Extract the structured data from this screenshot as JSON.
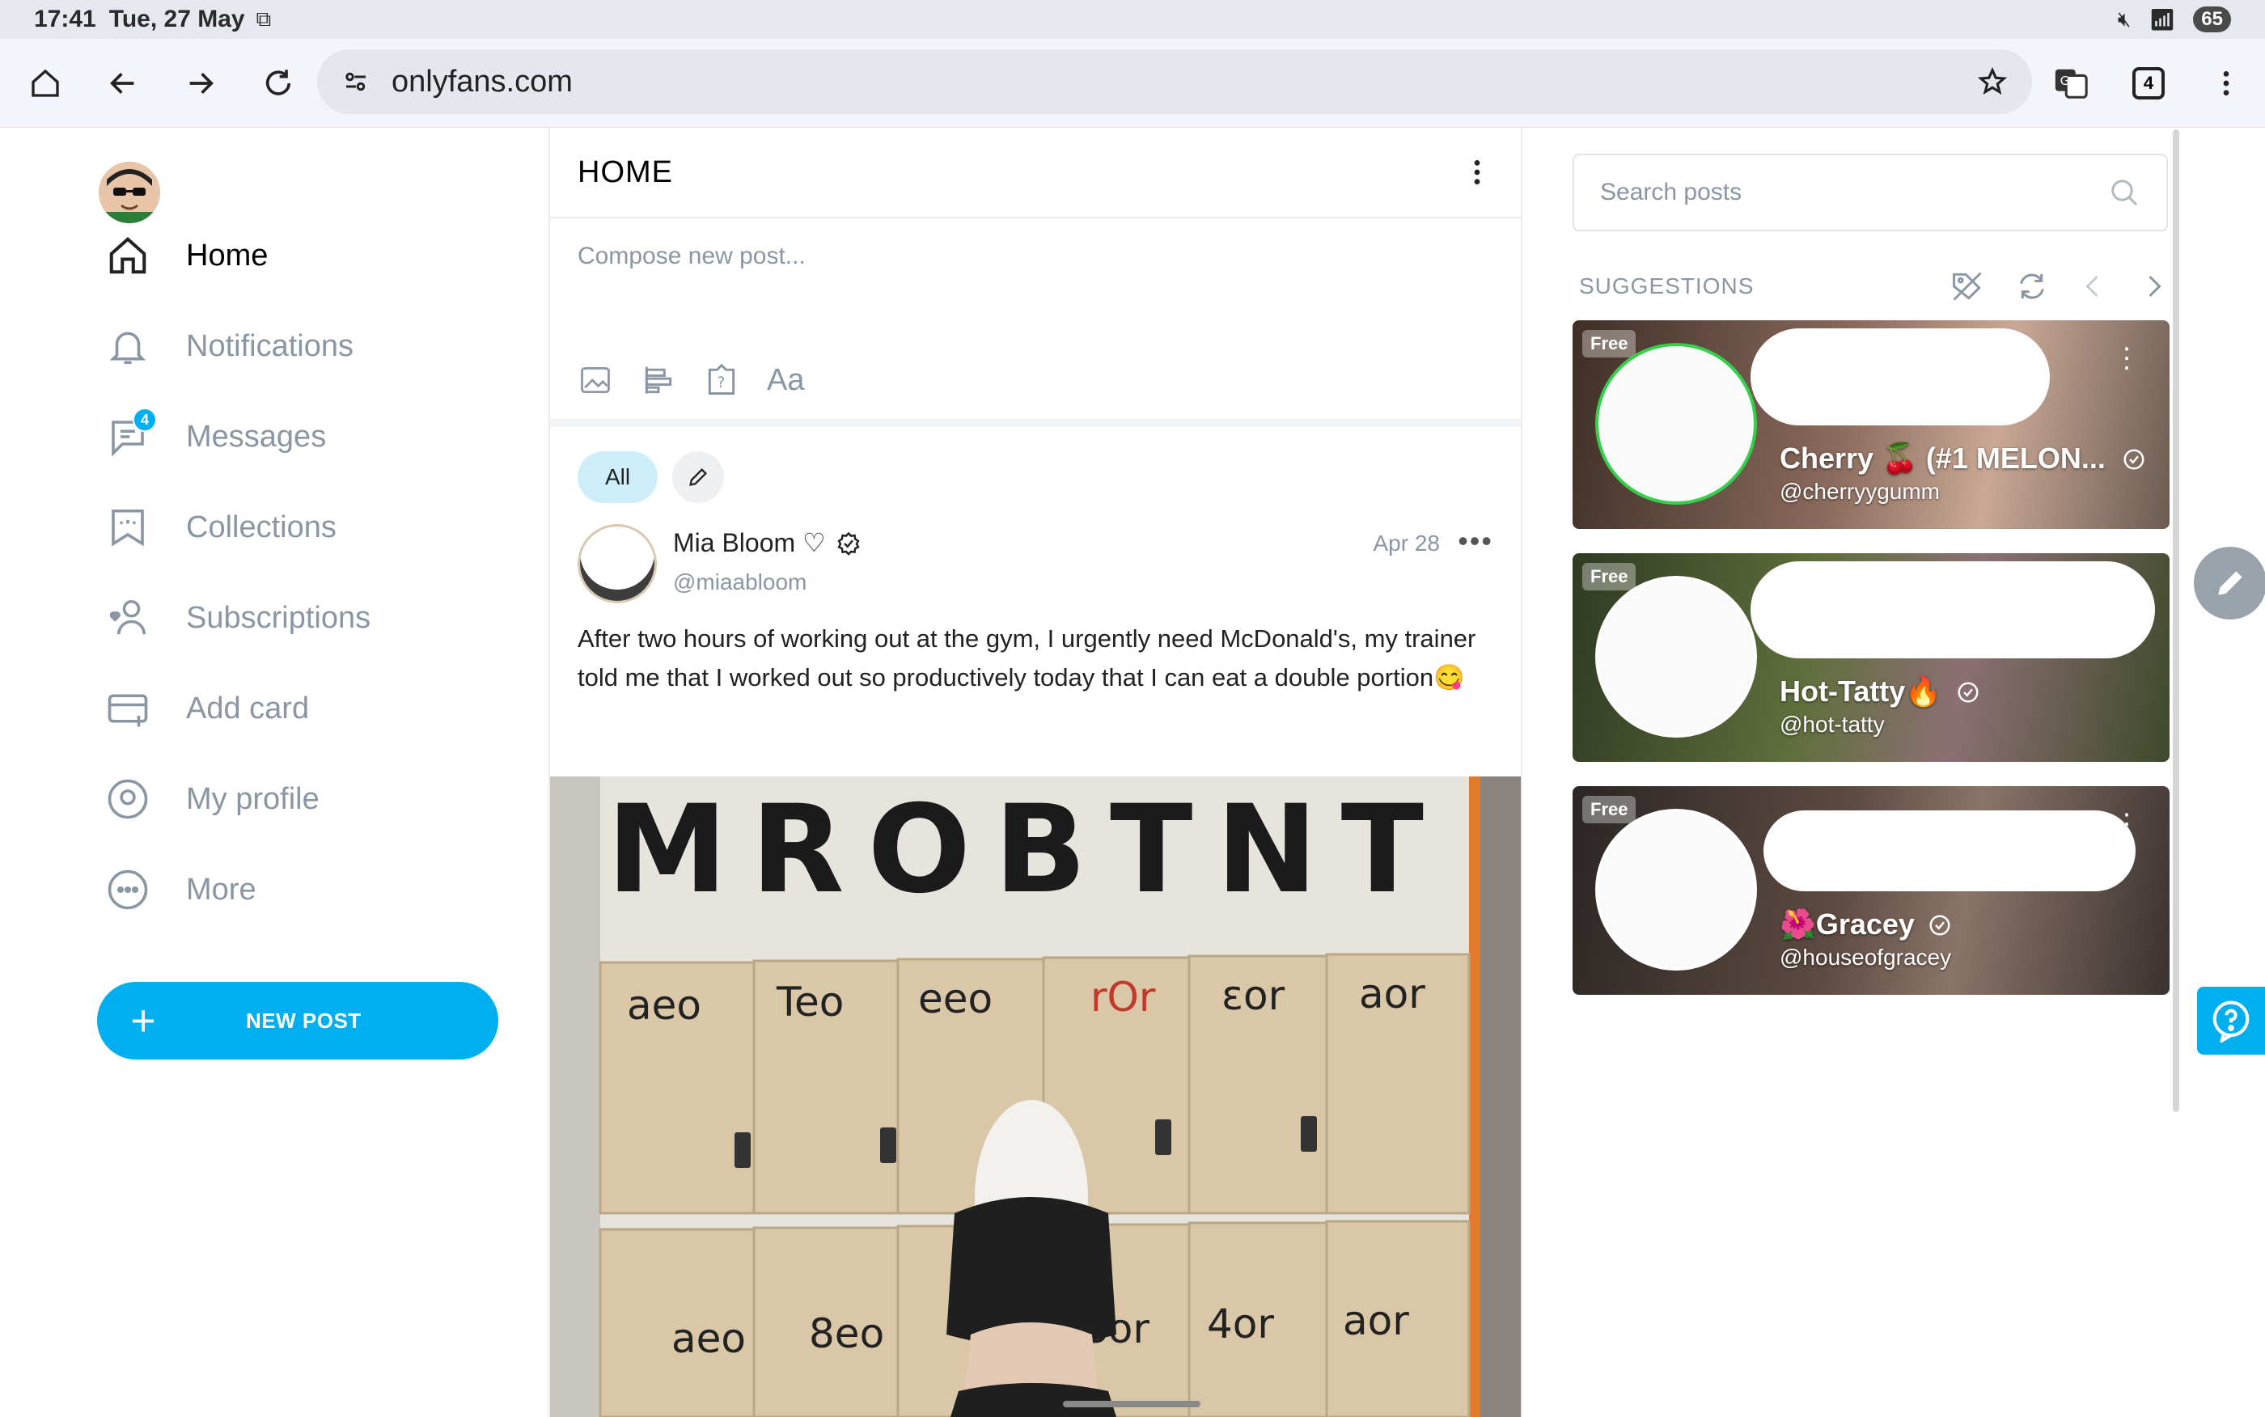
{
  "status": {
    "time": "17:41",
    "date": "Tue, 27 May",
    "battery": "65"
  },
  "browser": {
    "url": "onlyfans.com",
    "tab_count": "4"
  },
  "nav": {
    "items": [
      {
        "label": "Home"
      },
      {
        "label": "Notifications"
      },
      {
        "label": "Messages",
        "badge": "4"
      },
      {
        "label": "Collections"
      },
      {
        "label": "Subscriptions"
      },
      {
        "label": "Add card"
      },
      {
        "label": "My profile"
      },
      {
        "label": "More"
      }
    ],
    "new_post": "NEW POST"
  },
  "feed": {
    "title": "HOME",
    "compose_placeholder": "Compose new post...",
    "compose_font_tool": "Aa",
    "filter_all": "All",
    "post": {
      "name": "Mia Bloom ♡",
      "handle": "@miaabloom",
      "date": "Apr 28",
      "text": "After two hours of working out at the gym, I urgently need McDonald's, my trainer told me that I worked out so productively today that I can eat a double portion😋",
      "image_sign": "MROBTNT",
      "locker_numbers": [
        "aeo",
        "Teo",
        "eeo",
        "rOr",
        "εor",
        "aor",
        "aeo",
        "8eo",
        "Sor",
        "4or",
        "aor"
      ]
    }
  },
  "sidebar": {
    "search_placeholder": "Search posts",
    "suggestions_title": "SUGGESTIONS",
    "cards": [
      {
        "free": "Free",
        "name": "Cherry 🍒 (#1 MELON...",
        "handle": "@cherryygumm"
      },
      {
        "free": "Free",
        "name": "Hot-Tatty🔥",
        "handle": "@hot-tatty"
      },
      {
        "free": "Free",
        "name": "🌺Gracey",
        "handle": "@houseofgracey"
      }
    ]
  },
  "colors": {
    "accent": "#00aff0",
    "muted": "#8a96a3"
  }
}
